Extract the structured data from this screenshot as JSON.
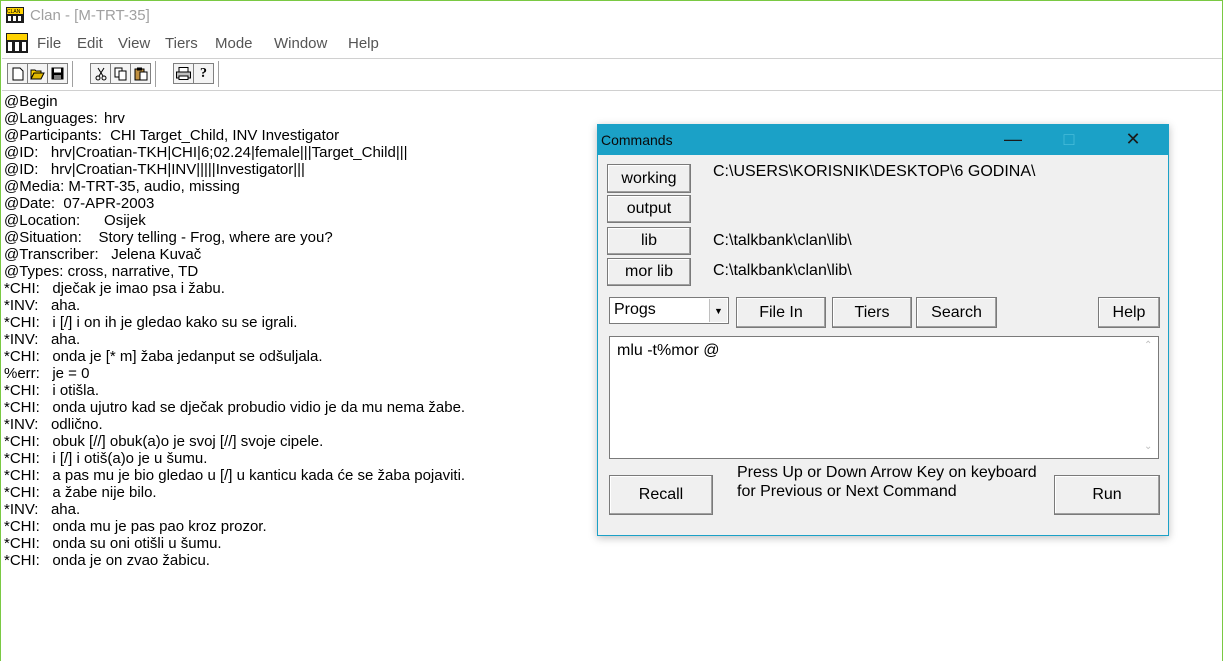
{
  "window": {
    "title": "Clan - [M-TRT-35]"
  },
  "menu": [
    "File",
    "Edit",
    "View",
    "Tiers",
    "Mode",
    "Window",
    "Help"
  ],
  "toolbar": {
    "buttons": [
      "new-icon",
      "open-icon",
      "save-icon",
      "cut-icon",
      "copy-icon",
      "paste-icon",
      "print-icon",
      "help-icon"
    ]
  },
  "transcript": [
    "@Begin",
    "@Languages:\thrv",
    "@Participants:  CHI Target_Child, INV Investigator",
    "@ID:   hrv|Croatian-TKH|CHI|6;02.24|female|||Target_Child|||",
    "@ID:   hrv|Croatian-TKH|INV|||||Investigator|||",
    "@Media: M-TRT-35, audio, missing",
    "@Date:  07-APR-2003",
    "@Location:\tOsijek",
    "@Situation:    Story telling - Frog, where are you?",
    "@Transcriber:   Jelena Kuvač",
    "@Types: cross, narrative, TD",
    "*CHI:   dječak je imao psa i žabu.",
    "*INV:   aha.",
    "*CHI:   i [/] i on ih je gledao kako su se igrali.",
    "*INV:   aha.",
    "*CHI:   onda je [* m] žaba jedanput se odšuljala.",
    "%err:   je = 0",
    "*CHI:   i otišla.",
    "*CHI:   onda ujutro kad se dječak probudio vidio je da mu nema žabe.",
    "*INV:   odlično.",
    "*CHI:   obuk [//] obuk(a)o je svoj [//] svoje cipele.",
    "*CHI:   i [/] i otiš(a)o je u šumu.",
    "*CHI:   a pas mu je bio gledao u [/] u kanticu kada će se žaba pojaviti.",
    "*CHI:   a žabe nije bilo.",
    "*INV:   aha.",
    "*CHI:   onda mu je pas pao kroz prozor.",
    "*CHI:   onda su oni otišli u šumu.",
    "*CHI:   onda je on zvao žabicu."
  ],
  "commands": {
    "title": "Commands",
    "working_label": "working",
    "working_path": "C:\\USERS\\KORISNIK\\DESKTOP\\6 GODINA\\",
    "output_label": "output",
    "lib_label": "lib",
    "lib_path": "C:\\talkbank\\clan\\lib\\",
    "morlib_label": "mor lib",
    "morlib_path": "C:\\talkbank\\clan\\lib\\",
    "progs_value": "Progs",
    "file_in_label": "File In",
    "tiers_label": "Tiers",
    "search_label": "Search",
    "help_label": "Help",
    "command_text": "mlu -t%mor @",
    "recall_label": "Recall",
    "hint": "Press Up or Down Arrow Key on keyboard for Previous or Next Command",
    "run_label": "Run"
  }
}
